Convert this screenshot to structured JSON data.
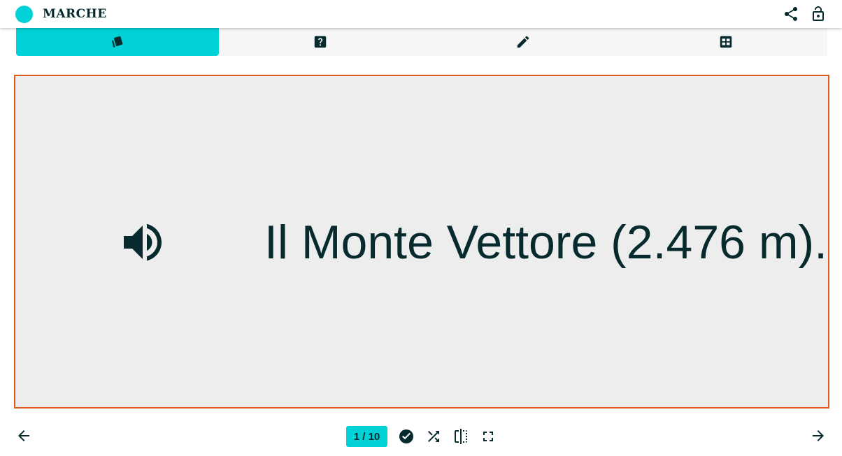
{
  "header": {
    "title": "MARCHE",
    "brand_color": "#00d1d6",
    "icons": [
      "share-icon",
      "lock-open-icon"
    ]
  },
  "tabs": [
    {
      "icon": "flashcards-icon",
      "active": true
    },
    {
      "icon": "question-icon",
      "active": false
    },
    {
      "icon": "pencil-icon",
      "active": false
    },
    {
      "icon": "grid-icon",
      "active": false
    }
  ],
  "card": {
    "text": "Il Monte Vettore (2.476 m).",
    "audio_icon": "speaker-icon",
    "border_color": "#e05a1a",
    "background": "#ededed"
  },
  "footer": {
    "counter": "1 / 10",
    "controls": [
      "check-icon",
      "shuffle-icon",
      "flip-icon",
      "fullscreen-icon"
    ],
    "prev_icon": "arrow-left-icon",
    "next_icon": "arrow-right-icon"
  },
  "colors": {
    "accent": "#00d1d6",
    "text": "#062a2e",
    "card_border": "#e05a1a"
  }
}
